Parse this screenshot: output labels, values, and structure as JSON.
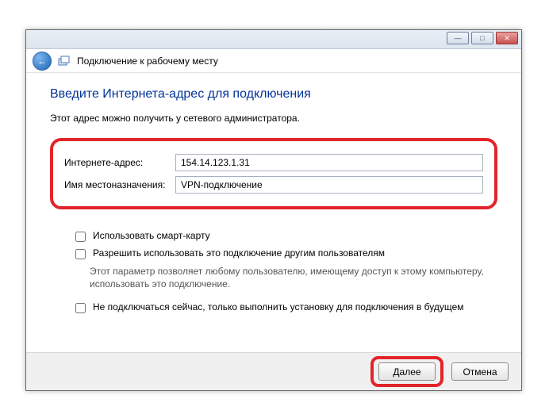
{
  "titlebar": {
    "minimize": "—",
    "maximize": "□",
    "close": "✕"
  },
  "nav": {
    "back_arrow": "←",
    "wizard_title": "Подключение к рабочему месту"
  },
  "heading": "Введите Интернета-адрес для подключения",
  "description": "Этот адрес можно получить у сетевого администратора.",
  "form": {
    "internet_address_label": "Интернете-адрес:",
    "internet_address_value": "154.14.123.1.31",
    "destination_name_label": "Имя местоназначения:",
    "destination_name_value": "VPN-подключение"
  },
  "options": {
    "smartcard_label": "Использовать смарт-карту",
    "allow_others_label": "Разрешить использовать это подключение другим пользователям",
    "allow_others_desc": "Этот параметр позволяет любому пользователю, имеющему доступ к этому компьютеру, использовать это подключение.",
    "dont_connect_label": "Не подключаться сейчас, только выполнить установку для подключения в будущем"
  },
  "footer": {
    "next": "Далее",
    "cancel": "Отмена"
  }
}
